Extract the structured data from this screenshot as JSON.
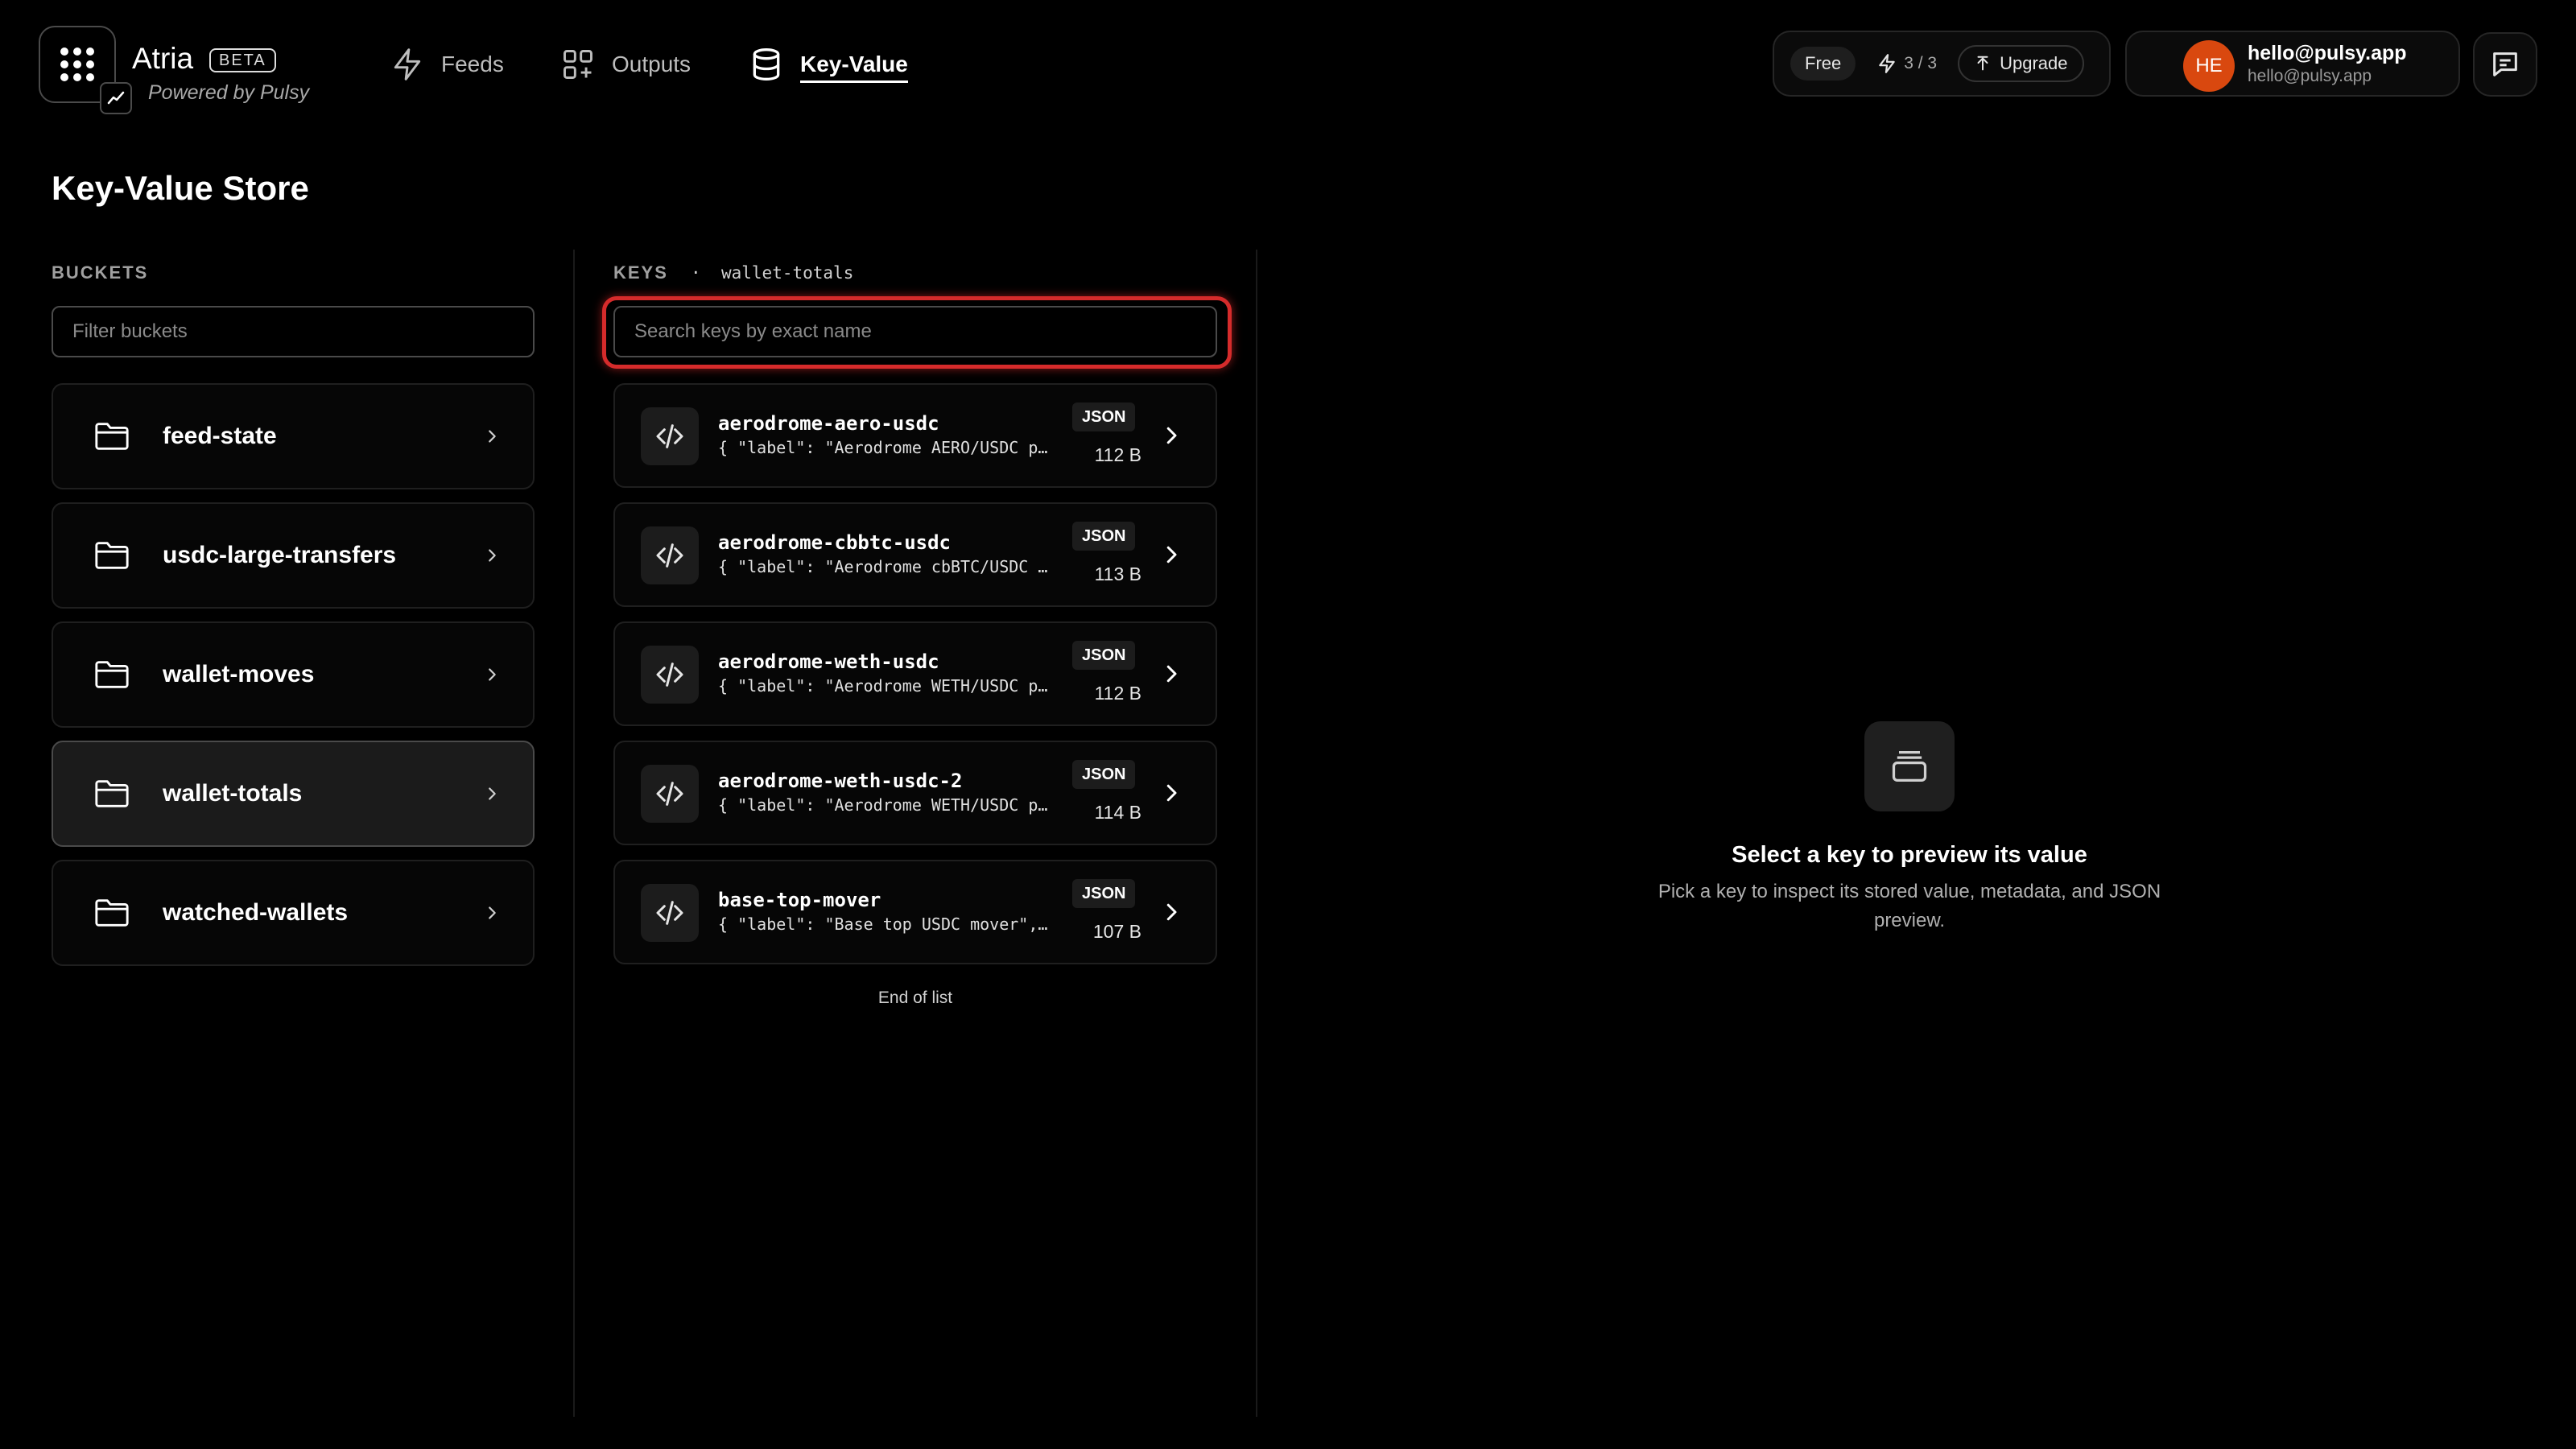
{
  "brand": {
    "name": "Atria",
    "badge": "BETA",
    "tagline": "Powered by Pulsy"
  },
  "nav": [
    {
      "label": "Feeds",
      "icon": "bolt-icon"
    },
    {
      "label": "Outputs",
      "icon": "grid-plus-icon"
    },
    {
      "label": "Key-Value",
      "icon": "database-icon",
      "active": true
    }
  ],
  "plan": {
    "tier": "Free",
    "usage": "3 / 3",
    "upgrade_label": "Upgrade"
  },
  "user": {
    "initials": "HE",
    "name": "hello@pulsy.app",
    "email": "hello@pulsy.app"
  },
  "page": {
    "title": "Key-Value Store"
  },
  "buckets": {
    "header": "BUCKETS",
    "filter_placeholder": "Filter buckets",
    "items": [
      {
        "label": "feed-state"
      },
      {
        "label": "usdc-large-transfers"
      },
      {
        "label": "wallet-moves"
      },
      {
        "label": "wallet-totals",
        "selected": true
      },
      {
        "label": "watched-wallets"
      }
    ]
  },
  "keys": {
    "header": "KEYS",
    "bucket": "wallet-totals",
    "search_placeholder": "Search keys by exact name",
    "items": [
      {
        "name": "aerodrome-aero-usdc",
        "preview": "{ \"label\": \"Aerodrome AERO/USDC p…",
        "type": "JSON",
        "size": "112 B"
      },
      {
        "name": "aerodrome-cbbtc-usdc",
        "preview": "{ \"label\": \"Aerodrome cbBTC/USDC …",
        "type": "JSON",
        "size": "113 B"
      },
      {
        "name": "aerodrome-weth-usdc",
        "preview": "{ \"label\": \"Aerodrome WETH/USDC p…",
        "type": "JSON",
        "size": "112 B"
      },
      {
        "name": "aerodrome-weth-usdc-2",
        "preview": "{ \"label\": \"Aerodrome WETH/USDC p…",
        "type": "JSON",
        "size": "114 B"
      },
      {
        "name": "base-top-mover",
        "preview": "{ \"label\": \"Base top USDC mover\",…",
        "type": "JSON",
        "size": "107 B"
      }
    ],
    "end_label": "End of list"
  },
  "preview": {
    "title": "Select a key to preview its value",
    "description": "Pick a key to inspect its stored value, metadata, and JSON preview."
  },
  "colors": {
    "accent_ring": "#d52b2b",
    "avatar": "#d9480f",
    "background": "#000000"
  }
}
